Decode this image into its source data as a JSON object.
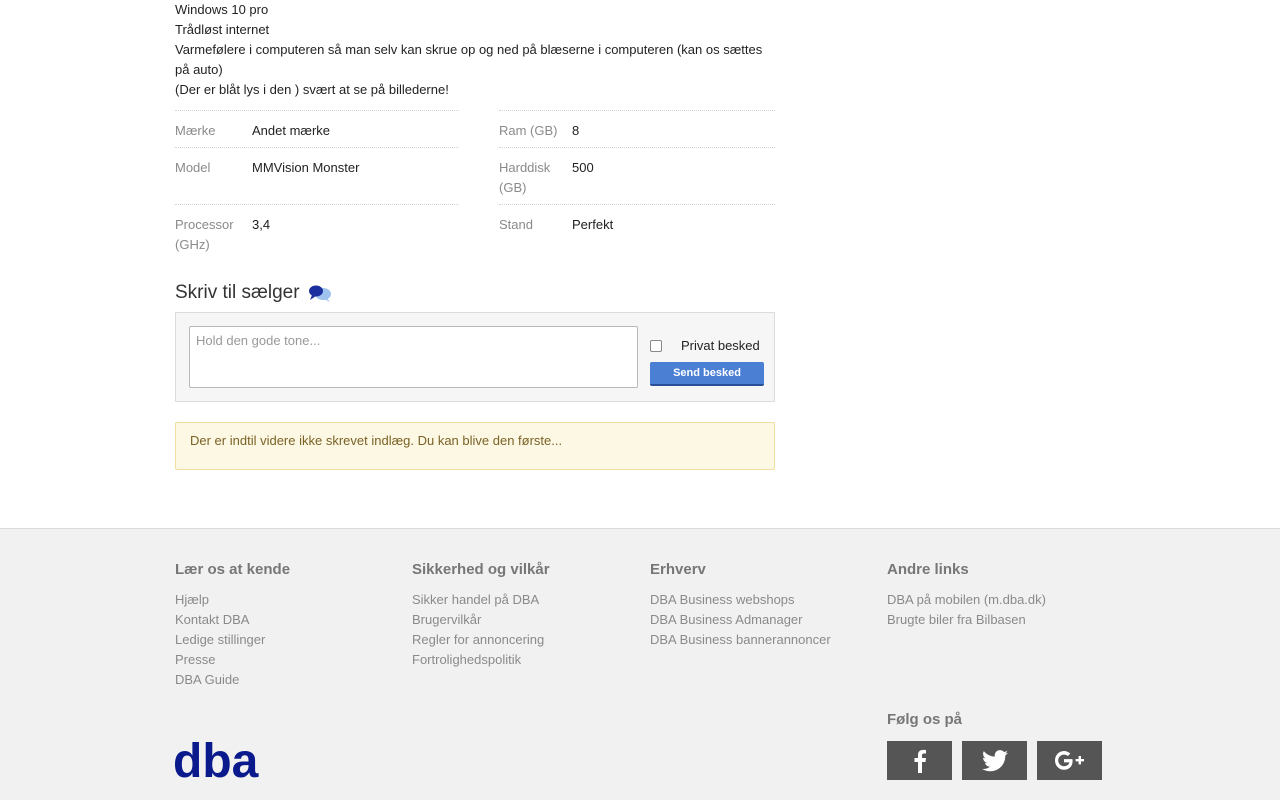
{
  "description_lines": [
    "Windows 10 pro",
    "Trådløst internet",
    "Varmefølere i computeren så man selv kan skrue op og ned på blæserne i computeren (kan os sættes på auto)",
    "(Der er blåt lys i den ) svært at se på billederne!"
  ],
  "specs": {
    "left": [
      {
        "key": "Mærke",
        "value": "Andet mærke"
      },
      {
        "key": "Model",
        "value": "MMVision Monster"
      },
      {
        "key": "Processor (GHz)",
        "value": "3,4"
      }
    ],
    "right": [
      {
        "key": "Ram (GB)",
        "value": "8"
      },
      {
        "key": "Harddisk (GB)",
        "value": "500"
      },
      {
        "key": "Stand",
        "value": "Perfekt"
      }
    ]
  },
  "message": {
    "title": "Skriv til sælger",
    "placeholder": "Hold den gode tone...",
    "private_label": "Privat besked",
    "send_label": "Send besked"
  },
  "notice": "Der er indtil videre ikke skrevet indlæg. Du kan blive den første...",
  "footer": {
    "columns": [
      {
        "title": "Lær os at kende",
        "links": [
          "Hjælp",
          "Kontakt DBA",
          "Ledige stillinger",
          "Presse",
          "DBA Guide"
        ]
      },
      {
        "title": "Sikkerhed og vilkår",
        "links": [
          "Sikker handel på DBA",
          "Brugervilkår",
          "Regler for annoncering",
          "Fortrolighedspolitik"
        ]
      },
      {
        "title": "Erhverv",
        "links": [
          "DBA Business webshops",
          "DBA Business Admanager",
          "DBA Business bannerannoncer"
        ]
      },
      {
        "title": "Andre links",
        "links": [
          "DBA på mobilen (m.dba.dk)",
          "Brugte biler fra Bilbasen"
        ]
      }
    ],
    "follow_label": "Følg os på",
    "social_icons": [
      "facebook-icon",
      "twitter-icon",
      "google-plus-icon"
    ],
    "logo_text": "dba"
  },
  "colors": {
    "send_button": "#4a7fd4",
    "logo": "#0a1a8c",
    "notice_bg": "#fdf8e3"
  }
}
